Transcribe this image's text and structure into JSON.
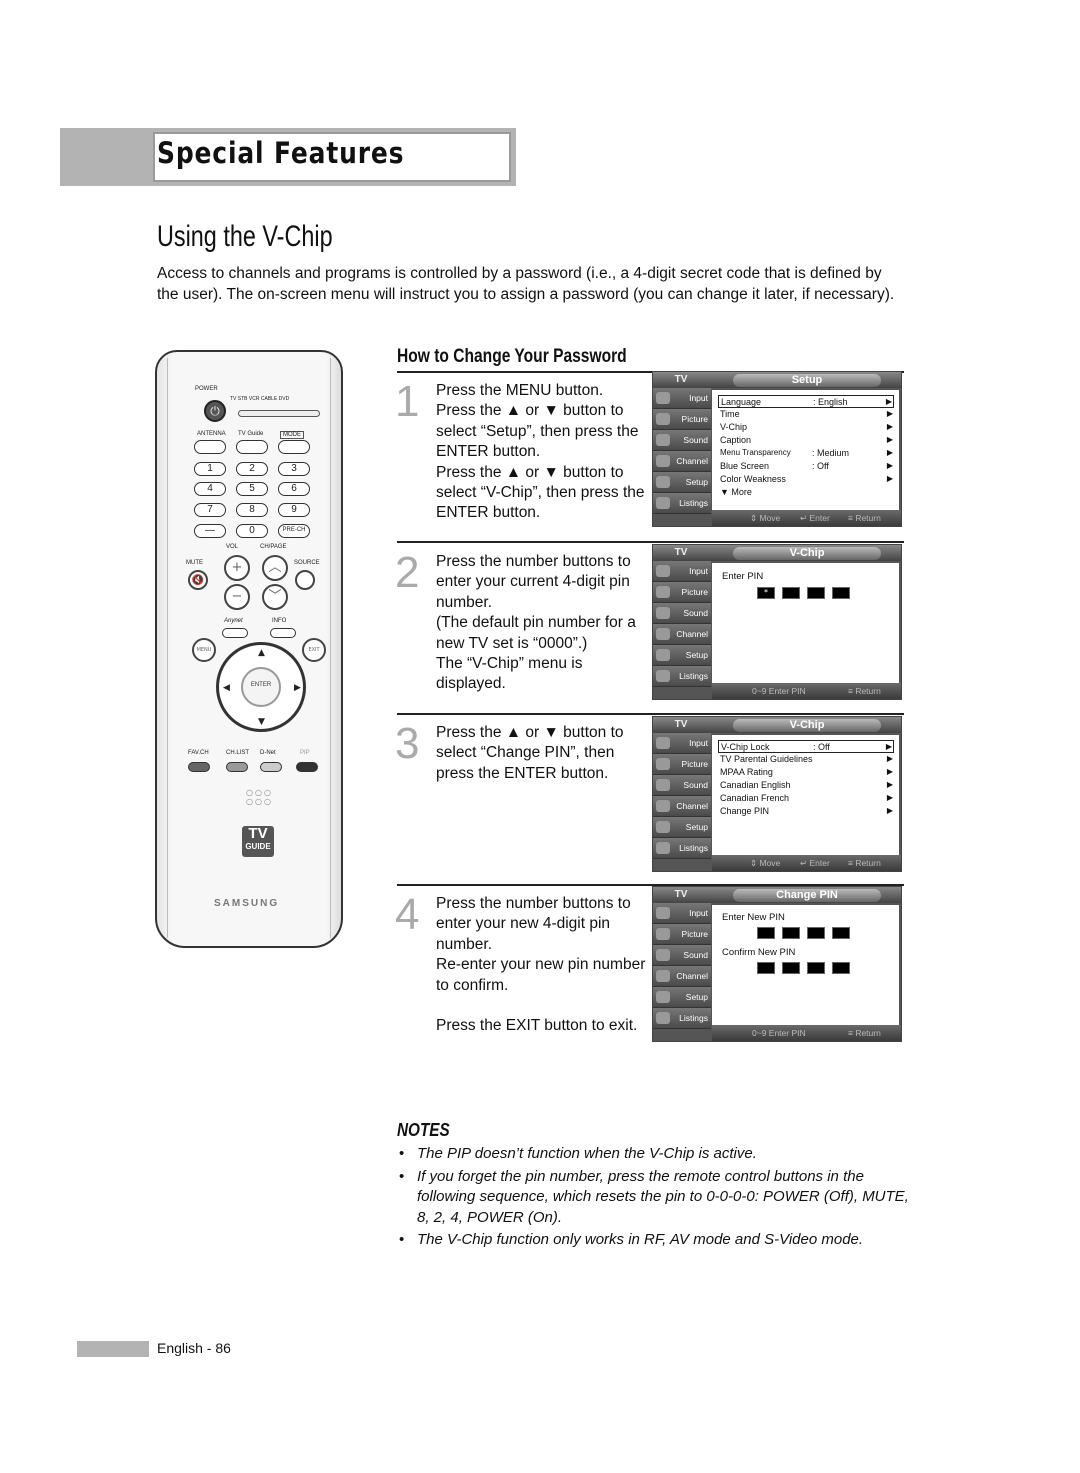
{
  "header": {
    "section": "Special Features"
  },
  "page": {
    "title": "Using the V-Chip",
    "intro": "Access to channels and programs is controlled by a password (i.e., a 4-digit secret code that is defined by the user). The on-screen menu will instruct you to assign a password (you can change it later, if necessary)."
  },
  "remote": {
    "power": "POWER",
    "modes": "TV  STB  VCR  CABLE  DVD",
    "antenna": "ANTENNA",
    "tvguide": "TV Guide",
    "mode": "MODE",
    "digits": [
      "1",
      "2",
      "3",
      "4",
      "5",
      "6",
      "7",
      "8",
      "9",
      "—",
      "0",
      "PRE-CH"
    ],
    "vol": "VOL",
    "chpage": "CH/PAGE",
    "mute": "MUTE",
    "source": "SOURCE",
    "anynet": "Anynet",
    "info": "INFO",
    "menu": "MENU",
    "exit": "EXIT",
    "enter": "ENTER",
    "favch": "FAV.CH",
    "chlist": "CH.LIST",
    "dnet": "D-Net",
    "pip": "PIP",
    "logo_big": "TV",
    "logo_small": "GUIDE",
    "brand": "SAMSUNG"
  },
  "section": {
    "title": "How to Change Your Password"
  },
  "steps": [
    {
      "num": "1",
      "lines": [
        "Press the MENU button.",
        "Press the ▲ or ▼ button to select “Setup”, then press the ENTER button.",
        "Press the ▲ or ▼ button to select “V-Chip”, then press the ENTER button."
      ]
    },
    {
      "num": "2",
      "lines": [
        "Press the number buttons to enter your current 4-digit pin number.",
        "(The default pin number for a new TV set is “0000”.)",
        "The “V-Chip” menu is displayed."
      ]
    },
    {
      "num": "3",
      "lines": [
        "Press the ▲ or ▼ button to select “Change PIN”, then press the ENTER button."
      ]
    },
    {
      "num": "4",
      "lines": [
        "Press the number buttons to enter your new 4-digit pin number.",
        "Re-enter your new pin number to confirm.",
        "",
        "Press the EXIT button to exit."
      ]
    }
  ],
  "osd_common": {
    "tv": "TV",
    "sidebar": [
      "Input",
      "Picture",
      "Sound",
      "Channel",
      "Setup",
      "Listings"
    ],
    "move": "⇕ Move",
    "enter": "↵ Enter",
    "return": "≡ Return",
    "enter_pin_hint": "0~9 Enter PIN"
  },
  "osd_setup": {
    "title": "Setup",
    "rows": [
      {
        "k": "Language",
        "v": ": English",
        "a": "▶"
      },
      {
        "k": "Time",
        "v": "",
        "a": "▶"
      },
      {
        "k": "V-Chip",
        "v": "",
        "a": "▶"
      },
      {
        "k": "Caption",
        "v": "",
        "a": "▶"
      },
      {
        "k": "Menu Transparency",
        "v": ": Medium",
        "a": "▶"
      },
      {
        "k": "Blue Screen",
        "v": ": Off",
        "a": "▶"
      },
      {
        "k": "Color Weakness",
        "v": "",
        "a": "▶"
      },
      {
        "k": "▼ More",
        "v": "",
        "a": ""
      }
    ]
  },
  "osd_pin": {
    "title": "V-Chip",
    "label": "Enter PIN",
    "first_digit": "*"
  },
  "osd_vchip": {
    "title": "V-Chip",
    "rows": [
      {
        "k": "V-Chip Lock",
        "v": ": Off",
        "a": "▶"
      },
      {
        "k": "TV Parental Guidelines",
        "v": "",
        "a": "▶"
      },
      {
        "k": "MPAA Rating",
        "v": "",
        "a": "▶"
      },
      {
        "k": "Canadian English",
        "v": "",
        "a": "▶"
      },
      {
        "k": "Canadian French",
        "v": "",
        "a": "▶"
      },
      {
        "k": "Change PIN",
        "v": "",
        "a": "▶"
      }
    ]
  },
  "osd_change": {
    "title": "Change PIN",
    "label_new": "Enter New PIN",
    "label_confirm": "Confirm New PIN"
  },
  "notes": {
    "title": "NOTES",
    "items": [
      "The PIP doesn’t function when the V-Chip is active.",
      "If you forget the pin number, press the remote control buttons in the following sequence, which resets the pin to 0-0-0-0: POWER (Off), MUTE, 8, 2, 4, POWER (On).",
      "The V-Chip function only works in RF, AV mode and S-Video mode."
    ]
  },
  "footer": {
    "page": "English - 86"
  }
}
